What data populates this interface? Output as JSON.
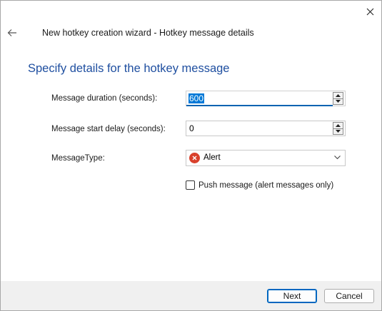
{
  "window": {
    "title": "New hotkey creation wizard - Hotkey message details",
    "close_icon": "close-icon",
    "back_icon": "back-arrow-icon"
  },
  "heading": "Specify details for the hotkey message",
  "fields": {
    "duration": {
      "label": "Message duration (seconds):",
      "value": "600"
    },
    "start_delay": {
      "label": "Message start delay (seconds):",
      "value": "0"
    },
    "message_type": {
      "label": "MessageType:",
      "value": "Alert",
      "icon": "alert-error-icon"
    }
  },
  "push_message": {
    "label": "Push message (alert messages only)",
    "checked": false
  },
  "buttons": {
    "next": "Next",
    "cancel": "Cancel"
  },
  "colors": {
    "heading": "#1f4fa0",
    "accent": "#0067c0",
    "alert": "#d9412c",
    "footer": "#f0f0f0"
  }
}
